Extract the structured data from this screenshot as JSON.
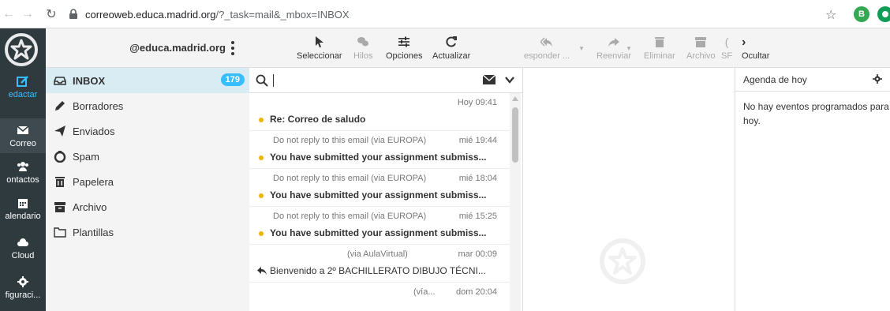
{
  "browser": {
    "url_host": "correoweb.educa.madrid.org",
    "url_path": "/?_task=mail&_mbox=INBOX",
    "profile_letter": "B"
  },
  "rail": {
    "items": [
      {
        "label": "edactar",
        "icon": "compose-icon"
      },
      {
        "label": "Correo",
        "icon": "envelope-icon"
      },
      {
        "label": "ontactos",
        "icon": "contacts-icon"
      },
      {
        "label": "alendario",
        "icon": "calendar-icon"
      },
      {
        "label": "Cloud",
        "icon": "cloud-icon"
      },
      {
        "label": "figuraci...",
        "icon": "gear-icon"
      }
    ]
  },
  "account": "@educa.madrid.org",
  "folders": [
    {
      "label": "INBOX",
      "icon": "inbox-icon",
      "count": "179"
    },
    {
      "label": "Borradores",
      "icon": "pencil-icon"
    },
    {
      "label": "Enviados",
      "icon": "send-icon"
    },
    {
      "label": "Spam",
      "icon": "spam-icon"
    },
    {
      "label": "Papelera",
      "icon": "trash-icon"
    },
    {
      "label": "Archivo",
      "icon": "archive-icon"
    },
    {
      "label": "Plantillas",
      "icon": "folder-icon"
    }
  ],
  "toolbar": {
    "seleccionar": "Seleccionar",
    "hilos": "Hilos",
    "opciones": "Opciones",
    "actualizar": "Actualizar",
    "responder": "esponder ...",
    "reenviar": "Reenviar",
    "eliminar": "Eliminar",
    "archivo": "Archivo",
    "sf": "SF",
    "ocultar": "Ocultar"
  },
  "messages": [
    {
      "from": "",
      "date": "Hoy 09:41",
      "subject": "Re: Correo de saludo",
      "unread": true
    },
    {
      "from": "Do not reply to this email (via EUROPA)",
      "date": "mié 19:44",
      "subject": "You have submitted your assignment submiss...",
      "unread": true
    },
    {
      "from": "Do not reply to this email (via EUROPA)",
      "date": "mié 18:04",
      "subject": "You have submitted your assignment submiss...",
      "unread": true
    },
    {
      "from": "Do not reply to this email (via EUROPA)",
      "date": "mié 15:25",
      "subject": "You have submitted your assignment submiss...",
      "unread": true
    },
    {
      "from": "(via AulaVirtual)",
      "date": "mar 00:09",
      "subject": "Bienvenido a 2º BACHILLERATO DIBUJO TÉCNI...",
      "unread": false,
      "replied": true
    },
    {
      "from": "(vía...",
      "date": "dom 20:04",
      "subject": "",
      "unread": false
    }
  ],
  "agenda": {
    "title": "Agenda de hoy",
    "empty_text": "No hay eventos programados para hoy."
  },
  "colors": {
    "accent": "#37beff",
    "rail": "#2f3a3f",
    "selected": "#d9ecf4",
    "unread_dot": "#f0b400"
  }
}
